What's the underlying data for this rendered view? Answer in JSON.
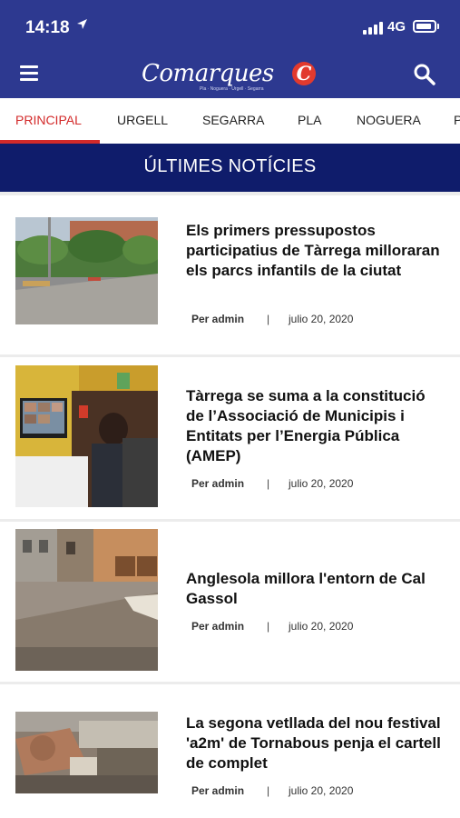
{
  "status_bar": {
    "time": "14:18",
    "location_icon": "location-arrow-icon",
    "network": "4G"
  },
  "header": {
    "menu_icon": "hamburger-menu-icon",
    "logo_text": "Comarques",
    "logo_tagline": "Pla · Noguera · Urgell · Segarra",
    "logo_mark": "C",
    "search_icon": "search-icon",
    "brand_color": "#2d3990",
    "accent_color": "#d32a2a"
  },
  "tabs": [
    {
      "label": "PRINCIPAL",
      "active": true
    },
    {
      "label": "URGELL"
    },
    {
      "label": "SEGARRA"
    },
    {
      "label": "PLA"
    },
    {
      "label": "NOGUERA"
    },
    {
      "label": "P"
    }
  ],
  "section_title": "ÚLTIMES NOTÍCIES",
  "articles": [
    {
      "title": "Els primers pressupostos participatius de Tàrrega milloraran els parcs infantils de la ciutat",
      "author": "Per admin",
      "separator": "|",
      "date": "julio 20, 2020"
    },
    {
      "title": "Tàrrega se suma a la constitució de l’Associació de Municipis i Entitats per l’Energia Pública (AMEP)",
      "author": "Per admin",
      "separator": "|",
      "date": "julio 20, 2020"
    },
    {
      "title": "Anglesola millora l'entorn de Cal Gassol",
      "author": "Per admin",
      "separator": "|",
      "date": "julio 20, 2020"
    },
    {
      "title": "La segona vetllada del nou festival 'a2m' de Tornabous penja el cartell de complet",
      "author": "Per admin",
      "separator": "|",
      "date": "julio 20, 2020"
    }
  ]
}
